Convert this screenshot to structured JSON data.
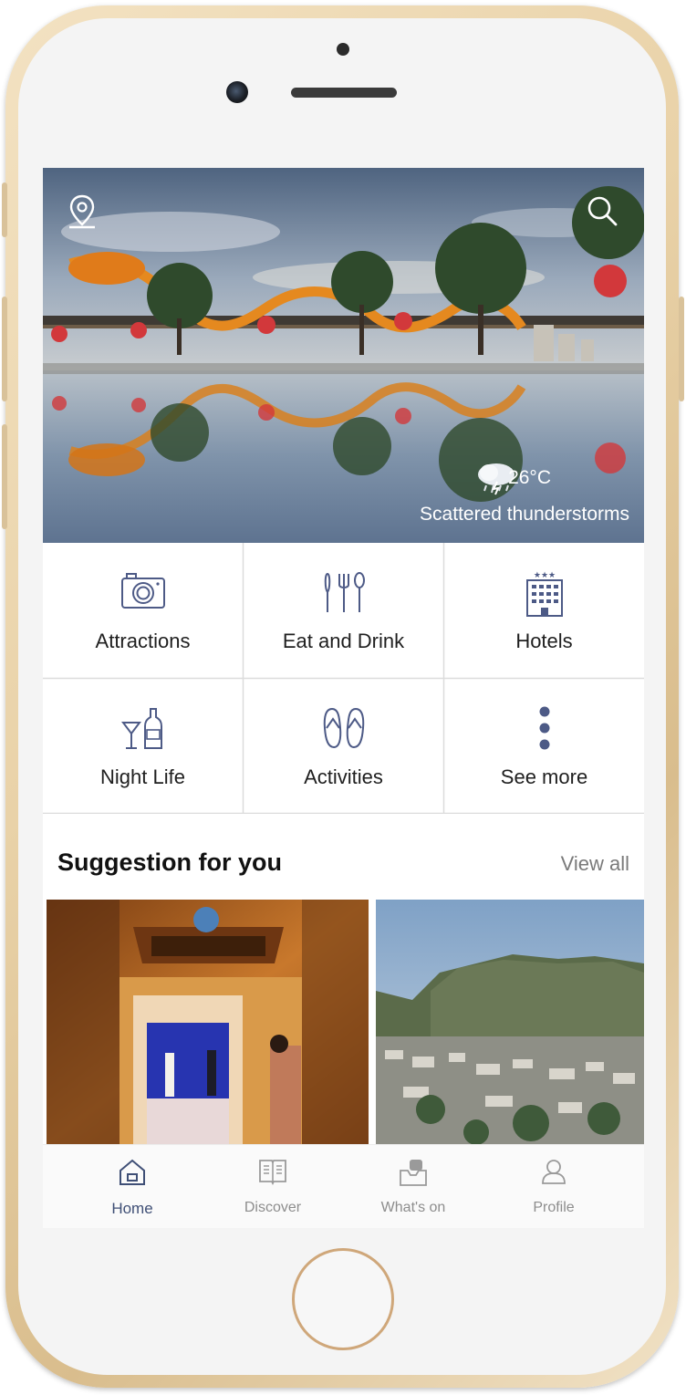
{
  "weather": {
    "temperature": "26°C",
    "condition": "Scattered thunderstorms"
  },
  "categories": [
    {
      "label": "Attractions",
      "icon": "camera-icon"
    },
    {
      "label": "Eat and Drink",
      "icon": "cutlery-icon"
    },
    {
      "label": "Hotels",
      "icon": "hotel-icon"
    },
    {
      "label": "Night Life",
      "icon": "cocktail-bottle-icon"
    },
    {
      "label": "Activities",
      "icon": "flip-flops-icon"
    },
    {
      "label": "See more",
      "icon": "more-vertical-icon"
    }
  ],
  "suggestions": {
    "title": "Suggestion for you",
    "view_all": "View all",
    "cards": [
      {
        "image": "museum-entrance-photo"
      },
      {
        "image": "marble-mountains-photo"
      }
    ]
  },
  "tabs": [
    {
      "label": "Home",
      "icon": "home-icon",
      "active": true
    },
    {
      "label": "Discover",
      "icon": "book-icon",
      "active": false
    },
    {
      "label": "What's on",
      "icon": "events-icon",
      "active": false
    },
    {
      "label": "Profile",
      "icon": "user-icon",
      "active": false
    }
  ],
  "colors": {
    "icon": "#4d5a86",
    "active_tab": "#3f4f76",
    "inactive_tab": "#8d8d8d",
    "divider": "#dcdcdc"
  }
}
